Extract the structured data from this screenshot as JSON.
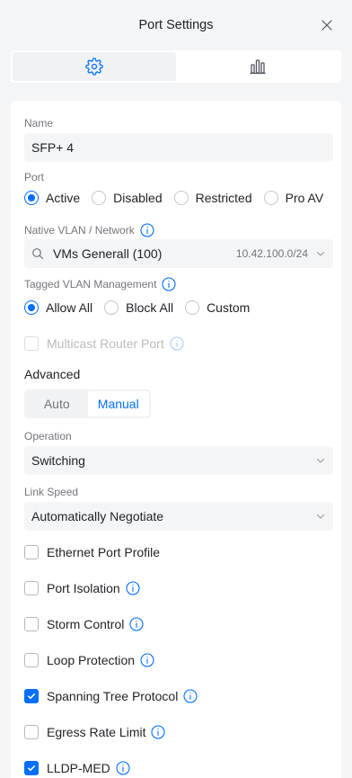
{
  "header": {
    "title": "Port Settings"
  },
  "tabs": [
    {
      "icon": "gear-icon",
      "active": true
    },
    {
      "icon": "bar-chart-icon",
      "active": false
    }
  ],
  "form": {
    "name_label": "Name",
    "name_value": "SFP+ 4",
    "port_label": "Port",
    "port_options": [
      "Active",
      "Disabled",
      "Restricted",
      "Pro AV"
    ],
    "port_selected": "Active",
    "native_vlan_label": "Native VLAN / Network",
    "native_vlan_value": "VMs Generall (100)",
    "native_vlan_subnet": "10.42.100.0/24",
    "tagged_label": "Tagged VLAN Management",
    "tagged_options": [
      "Allow All",
      "Block All",
      "Custom"
    ],
    "tagged_selected": "Allow All",
    "multicast_label": "Multicast Router Port",
    "advanced_label": "Advanced",
    "mode_options": [
      "Auto",
      "Manual"
    ],
    "mode_selected": "Manual",
    "operation_label": "Operation",
    "operation_value": "Switching",
    "link_speed_label": "Link Speed",
    "link_speed_value": "Automatically Negotiate",
    "checks": [
      {
        "label": "Ethernet Port Profile",
        "checked": false,
        "info": false
      },
      {
        "label": "Port Isolation",
        "checked": false,
        "info": true
      },
      {
        "label": "Storm Control",
        "checked": false,
        "info": true
      },
      {
        "label": "Loop Protection",
        "checked": false,
        "info": true
      },
      {
        "label": "Spanning Tree Protocol",
        "checked": true,
        "info": true
      },
      {
        "label": "Egress Rate Limit",
        "checked": false,
        "info": true
      },
      {
        "label": "LLDP-MED",
        "checked": true,
        "info": true
      }
    ]
  },
  "colors": {
    "accent": "#006fff",
    "text": "#212327",
    "muted": "#72757b",
    "field_bg": "#f4f5f6"
  }
}
